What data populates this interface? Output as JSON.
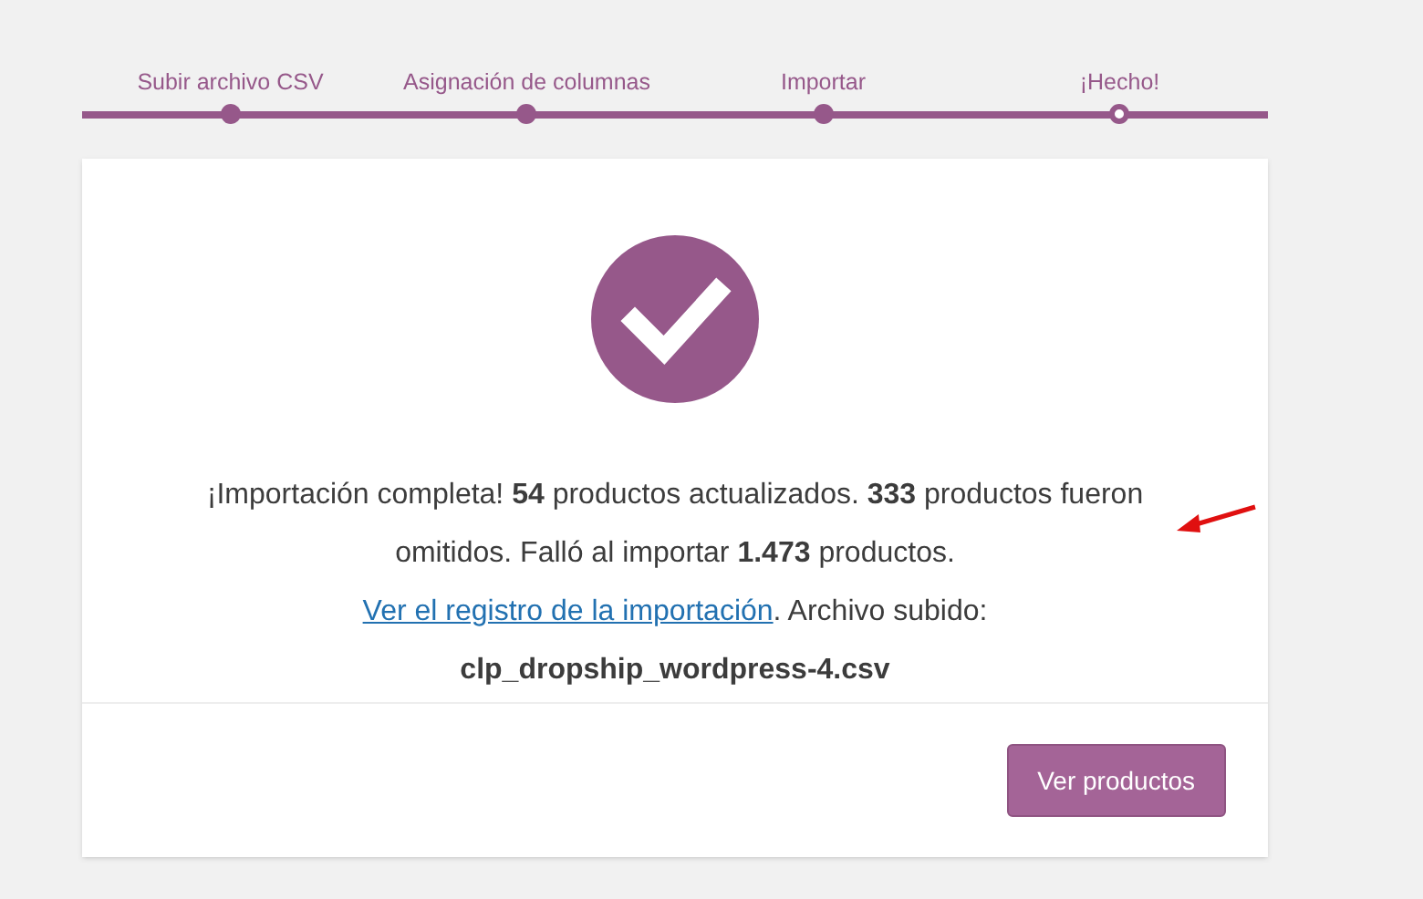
{
  "steps": [
    {
      "label": "Subir archivo CSV",
      "selected": false
    },
    {
      "label": "Asignación de columnas",
      "selected": false
    },
    {
      "label": "Importar",
      "selected": false
    },
    {
      "label": "¡Hecho!",
      "selected": true
    }
  ],
  "message": {
    "before": "¡Importación completa! **54** productos actualizados. **333** productos fueron omitidos. Falló al importar **1.473** productos. ",
    "link": "Ver el registro de la importación",
    "after": ". Archivo subido: **clp_dropship_wordpress-4.csv**"
  },
  "button": "Ver productos"
}
